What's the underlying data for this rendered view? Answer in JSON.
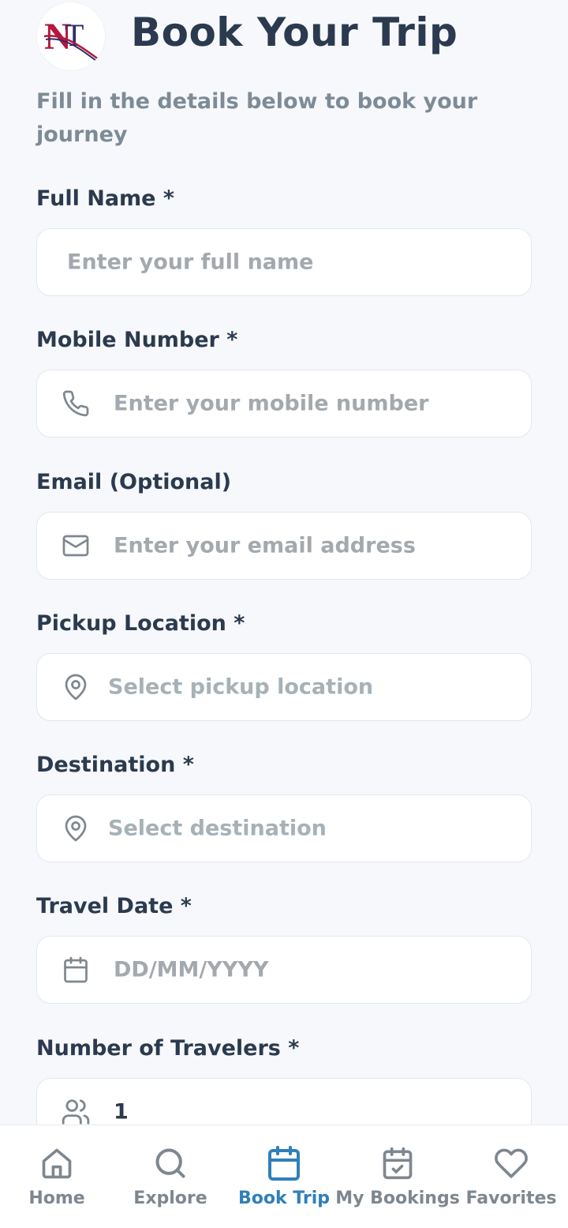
{
  "header": {
    "title": "Book Your Trip",
    "subtitle": "Fill in the details below to book your journey",
    "logo_text": "NT"
  },
  "form": {
    "full_name": {
      "label": "Full Name *",
      "placeholder": "Enter your full name"
    },
    "mobile": {
      "label": "Mobile Number *",
      "placeholder": "Enter your mobile number",
      "icon": "phone-icon"
    },
    "email": {
      "label": "Email (Optional)",
      "placeholder": "Enter your email address",
      "icon": "mail-icon"
    },
    "pickup": {
      "label": "Pickup Location *",
      "placeholder": "Select pickup location",
      "icon": "location-pin-icon"
    },
    "destination": {
      "label": "Destination *",
      "placeholder": "Select destination",
      "icon": "location-pin-icon"
    },
    "travel_date": {
      "label": "Travel Date *",
      "placeholder": "DD/MM/YYYY",
      "icon": "calendar-icon"
    },
    "travelers": {
      "label": "Number of Travelers *",
      "value": "1",
      "icon": "users-icon"
    }
  },
  "nav": {
    "items": [
      {
        "label": "Home",
        "icon": "home-icon",
        "active": false
      },
      {
        "label": "Explore",
        "icon": "search-icon",
        "active": false
      },
      {
        "label": "Book Trip",
        "icon": "calendar-icon",
        "active": true
      },
      {
        "label": "My Bookings",
        "icon": "calendar-check-icon",
        "active": false
      },
      {
        "label": "Favorites",
        "icon": "heart-icon",
        "active": false
      }
    ]
  },
  "colors": {
    "accent": "#2f7fba",
    "text_dark": "#2b3a4e",
    "text_muted": "#7d8b96",
    "placeholder": "#a3a9ae",
    "logo_red": "#b5173f",
    "logo_navy": "#2a2f6b"
  }
}
